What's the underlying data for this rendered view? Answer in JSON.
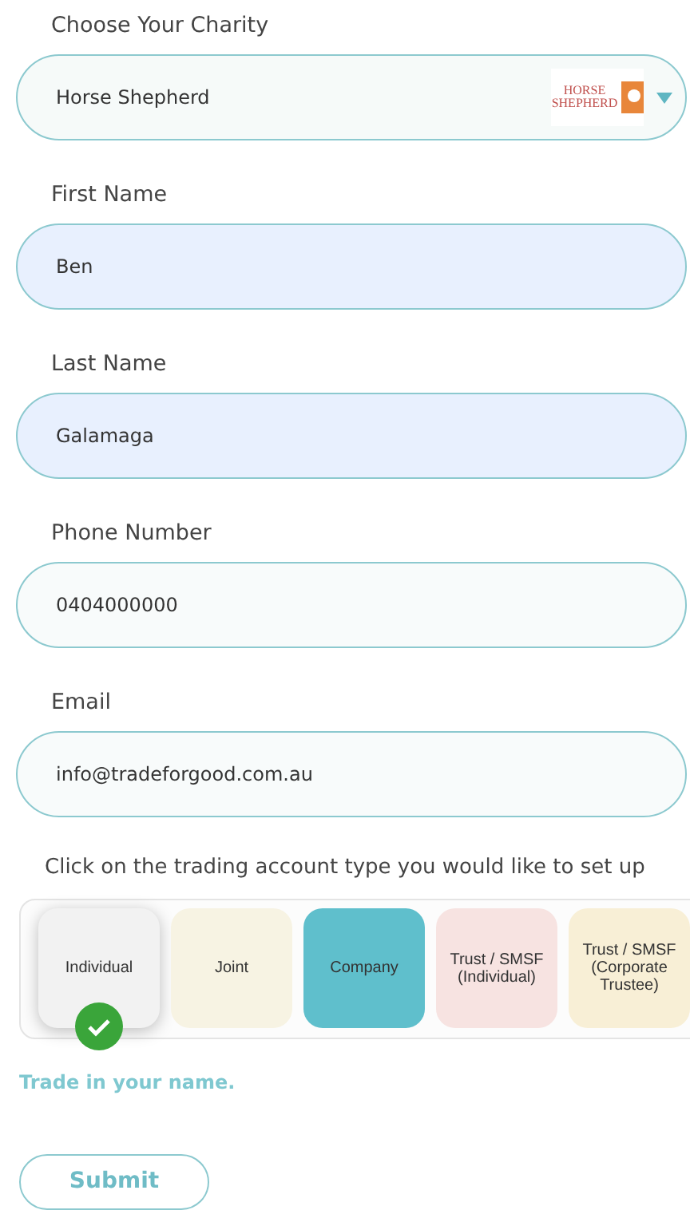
{
  "charity": {
    "label": "Choose Your Charity",
    "value": "Horse Shepherd",
    "logo": {
      "line_1": "HORSE",
      "line_2": "SHEPHERD"
    }
  },
  "fields": [
    {
      "label": "First Name",
      "value": "Ben",
      "autofilled": true
    },
    {
      "label": "Last Name",
      "value": "Galamaga",
      "autofilled": true
    },
    {
      "label": "Phone Number",
      "value": "0404000000",
      "autofilled": false
    },
    {
      "label": "Email",
      "value": "info@tradeforgood.com.au",
      "autofilled": false
    }
  ],
  "account_type": {
    "prompt": "Click on the trading account type you would like to set up",
    "options": [
      {
        "label": "Individual",
        "selected": true,
        "color": "#f2f2f2"
      },
      {
        "label": "Joint",
        "selected": false,
        "color": "#f7f3e3"
      },
      {
        "label": "Company",
        "selected": false,
        "color": "#5fbfcc"
      },
      {
        "label": "Trust / SMSF (Individual)",
        "selected": false,
        "color": "#f7e3e1"
      },
      {
        "label": "Trust / SMSF (Corporate Trustee)",
        "selected": false,
        "color": "#f8efd6"
      }
    ],
    "description": "Trade in your name."
  },
  "submit": {
    "label": "Submit"
  }
}
